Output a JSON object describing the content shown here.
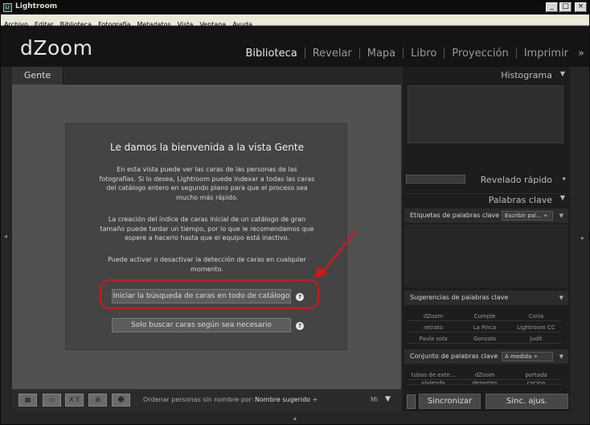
{
  "window": {
    "title": "Lightroom",
    "app_icon": "Lr",
    "min": "_",
    "max": "□",
    "close": "×"
  },
  "menu": [
    "Archivo",
    "Editar",
    "Biblioteca",
    "Fotografía",
    "Metadatos",
    "Vista",
    "Ventana",
    "Ayuda"
  ],
  "identity": {
    "logo": "dZoom",
    "more": "»"
  },
  "modules": [
    "Biblioteca",
    "Revelar",
    "Mapa",
    "Libro",
    "Proyección",
    "Imprimir"
  ],
  "view_tab": "Gente",
  "welcome": {
    "title": "Le damos la bienvenida a la vista Gente",
    "p1": "En esta vista puede ver las caras de las personas de las fotografías. Si lo desea, Lightroom puede indexar a todas las caras del catálogo entero en segundo plano para que el proceso sea mucho más rápido.",
    "p2": "La creación del índice de caras inicial de un catálogo de gran tamaño puede tardar un tiempo, por lo que le recomendamos que espere a hacerlo hasta que el equipo está inactivo.",
    "p3": "Puede activar o desactivar la detección de caras en cualquier momento.",
    "btn_all": "Iniciar la búsqueda de caras en todo de catálogo",
    "btn_needed": "Solo buscar caras según sea necesario",
    "help": "?"
  },
  "toolbar": {
    "sort_label": "Ordenar personas sin nombre por:",
    "sort_value": "Nombre sugerido ÷",
    "xy": "X Y",
    "more": "Mi"
  },
  "right_panel": {
    "histogram": "Histograma",
    "quick_develop": "Revelado rápido",
    "keywords": "Palabras clave",
    "tags": "Etiquetas de palabras clave",
    "tags_select": "Escribir pal... ÷",
    "suggestions": "Sugerencias de palabras clave",
    "suggest_items": [
      "dZoom",
      "Cumple",
      "Coria",
      "retrato",
      "La Finca",
      "Lightroom CC",
      "Paula sola",
      "Gonzalo",
      "Judit"
    ],
    "set": "Conjunto de palabras clave",
    "set_select": "A medida ÷",
    "set_items": [
      "tubos de exte...",
      "dZoom",
      "portada",
      "vivienda",
      "deportes",
      "cocina"
    ],
    "sync": "Sincronizar",
    "sync_settings": "Sinc. ajus."
  }
}
